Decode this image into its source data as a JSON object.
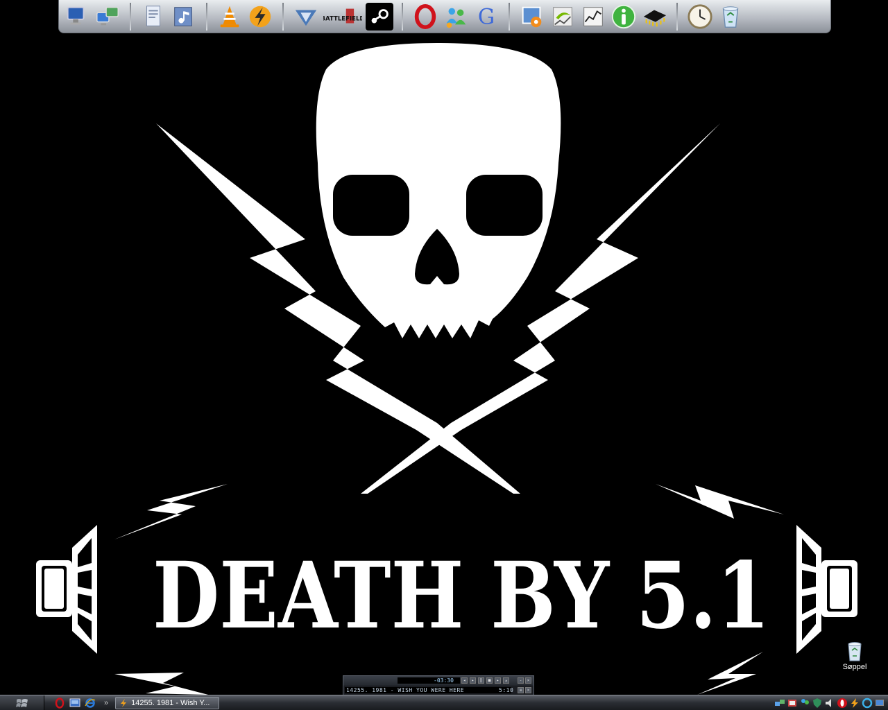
{
  "wallpaper": {
    "headline": "DEATH BY 5.1",
    "colors": {
      "background": "#000000",
      "foreground": "#ffffff"
    }
  },
  "dock": {
    "groups": [
      {
        "items": [
          {
            "icon": "my-computer-icon"
          },
          {
            "icon": "network-icon"
          }
        ]
      },
      {
        "items": [
          {
            "icon": "documents-icon"
          },
          {
            "icon": "music-folder-icon"
          }
        ]
      },
      {
        "items": [
          {
            "icon": "vlc-icon"
          },
          {
            "icon": "winamp-icon"
          }
        ]
      },
      {
        "items": [
          {
            "icon": "battlefield-2142-icon"
          },
          {
            "icon": "battlefield-2-icon",
            "label": "BATTLEFIELD"
          },
          {
            "icon": "steam-icon"
          }
        ]
      },
      {
        "items": [
          {
            "icon": "opera-icon"
          },
          {
            "icon": "msn-messenger-icon"
          },
          {
            "icon": "google-icon",
            "label": "G"
          }
        ]
      },
      {
        "items": [
          {
            "icon": "photo-viewer-icon"
          },
          {
            "icon": "nvidia-icon"
          },
          {
            "icon": "task-manager-icon"
          },
          {
            "icon": "info-icon"
          },
          {
            "icon": "cpu-chip-icon"
          }
        ]
      },
      {
        "items": [
          {
            "icon": "clock-icon"
          },
          {
            "icon": "recycle-bin-icon"
          }
        ]
      }
    ]
  },
  "desktop": {
    "icons": [
      {
        "label": "Søppel",
        "icon": "recycle-bin-icon"
      }
    ]
  },
  "winamp": {
    "elapsed": "-03:30",
    "track": "14255. 1981 - WISH YOU WERE HERE",
    "duration": "5:10"
  },
  "taskbar": {
    "quick_launch": [
      "opera-icon",
      "show-desktop-icon",
      "internet-explorer-icon"
    ],
    "chevron": "»",
    "task": {
      "label": "14255. 1981 - Wish Y...",
      "icon": "winamp-icon"
    },
    "tray": [
      "network-icon",
      "media-icon",
      "messenger-icon",
      "shield-icon",
      "speaker-icon",
      "opera-icon",
      "winamp-icon",
      "update-icon",
      "display-icon"
    ]
  }
}
